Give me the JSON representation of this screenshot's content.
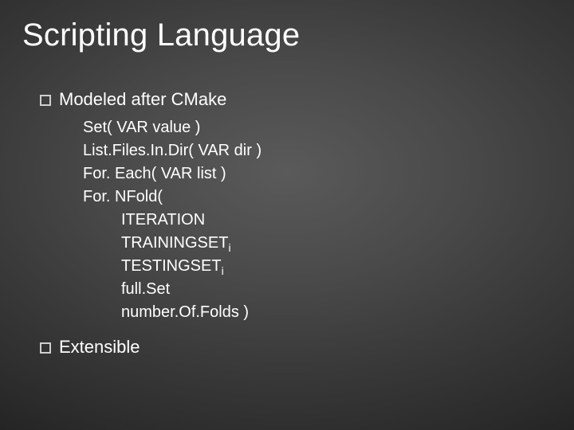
{
  "title": "Scripting Language",
  "bullets": {
    "b1": "Modeled after CMake",
    "b2": "Extensible"
  },
  "code": {
    "l1": "Set( VAR value )",
    "l2": "List.Files.In.Dir( VAR dir )",
    "l3": "For. Each( VAR list )",
    "l4": "For. NFold(",
    "l5": "ITERATION",
    "l6a": "TRAININGSET",
    "l6b": "i",
    "l7a": "TESTINGSET",
    "l7b": "i",
    "l8": "full.Set",
    "l9": "number.Of.Folds )"
  }
}
